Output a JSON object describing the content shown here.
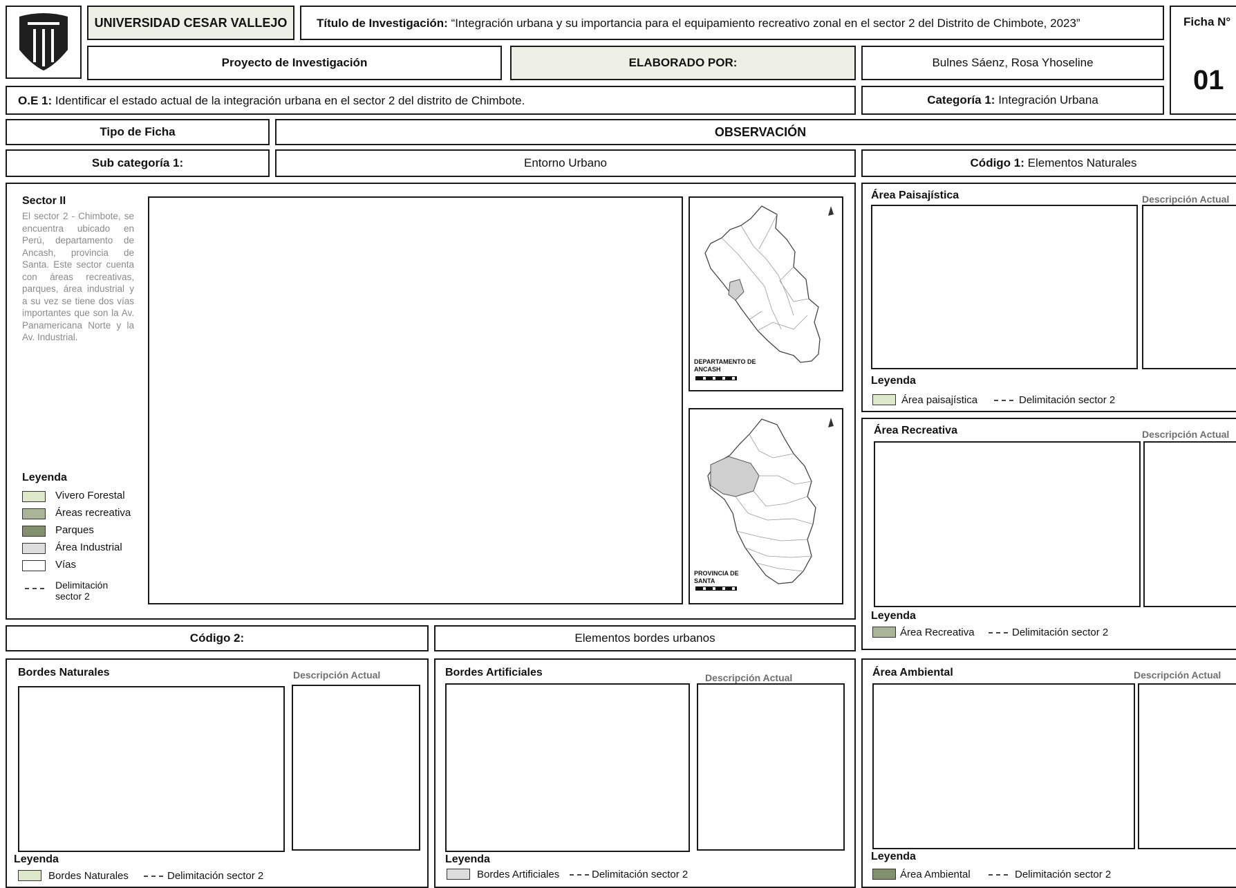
{
  "header": {
    "university": "UNIVERSIDAD CESAR VALLEJO",
    "title_label": "Título de Investigación:",
    "title_text": "“Integración urbana y su importancia para el equipamiento recreativo zonal en el sector 2 del Distrito de Chimbote, 2023”",
    "ficha_label": "Ficha N°",
    "ficha_number": "01",
    "project_label": "Proyecto de Investigación",
    "elaborado_label": "ELABORADO POR:",
    "author": "Bulnes Sáenz, Rosa Yhoseline",
    "oe_label": "O.E 1:",
    "oe_text": "Identificar el estado actual de la integración urbana en el sector 2 del distrito de Chimbote.",
    "category_label": "Categoría 1:",
    "category_value": "Integración Urbana"
  },
  "meta": {
    "tipo_label": "Tipo de Ficha",
    "tipo_value": "OBSERVACIÓN",
    "subcat_label": "Sub categoría 1:",
    "subcat_value": "Entorno Urbano",
    "code1_label": "Código 1:",
    "code1_value": "Elementos Naturales",
    "code2_label": "Código 2:",
    "code2_value": "Elementos bordes urbanos"
  },
  "sector": {
    "title": "Sector II",
    "description": "El sector 2 - Chimbote, se encuentra ubicado en Perú, departamento de Ancash, provincia de Santa. Este sector cuenta con áreas recreativas, parques, área industrial y a su vez se tiene dos vías importantes que son la Av. Panamericana Norte y la Av. Industrial.",
    "legend_title": "Leyenda",
    "legend": [
      {
        "label": "Vivero Forestal",
        "color": "#dde8c8"
      },
      {
        "label": "Áreas recreativa",
        "color": "#a9b596"
      },
      {
        "label": "Parques",
        "color": "#848f6d"
      },
      {
        "label": "Área Industrial",
        "color": "#dddddd"
      },
      {
        "label": "Vías",
        "color": "#ffffff"
      }
    ],
    "legend_dash_label": "Delimitación sector 2",
    "map1_label": "DEPARTAMENTO DE ANCASH",
    "map2_label": "PROVINCIA DE SANTA"
  },
  "panels": {
    "paisajistica": {
      "title": "Área Paisajística",
      "desc": "Descripción Actual",
      "legend_title": "Leyenda",
      "swatch_label": "Área paisajística",
      "swatch_color": "#dde8c8",
      "dash_label": "Delimitación sector 2"
    },
    "recreativa": {
      "title": "Área Recreativa",
      "desc": "Descripción Actual",
      "legend_title": "Leyenda",
      "swatch_label": "Área Recreativa",
      "swatch_color": "#a9b596",
      "dash_label": "Delimitación sector 2"
    },
    "bordes_naturales": {
      "title": "Bordes Naturales",
      "desc": "Descripción Actual",
      "legend_title": "Leyenda",
      "swatch_label": "Bordes Naturales",
      "swatch_color": "#dde8c8",
      "dash_label": "Delimitación sector 2"
    },
    "bordes_artificiales": {
      "title": "Bordes Artificiales",
      "desc": "Descripción Actual",
      "legend_title": "Leyenda",
      "swatch_label": "Bordes Artificiales",
      "swatch_color": "#dddddd",
      "dash_label": "Delimitación sector 2"
    },
    "ambiental": {
      "title": "Área Ambiental",
      "desc": "Descripción Actual",
      "legend_title": "Leyenda",
      "swatch_label": "Área Ambiental",
      "swatch_color": "#848f6d",
      "dash_label": "Delimitación sector 2"
    }
  }
}
